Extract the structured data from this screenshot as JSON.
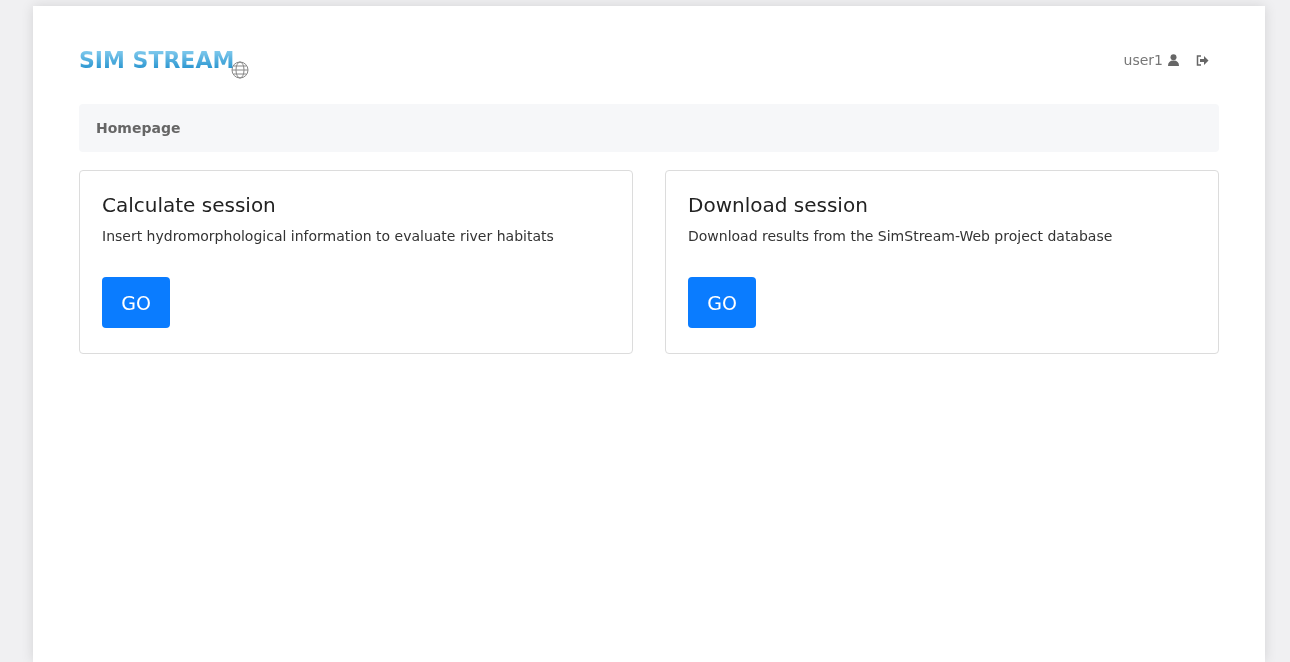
{
  "header": {
    "logo": "SIM STREAM",
    "user": "user1"
  },
  "breadcrumb": {
    "label": "Homepage"
  },
  "cards": [
    {
      "title": "Calculate session",
      "text": "Insert hydromorphological information to evaluate river habitats",
      "button": "GO"
    },
    {
      "title": "Download session",
      "text": "Download results from the SimStream-Web project database",
      "button": "GO"
    }
  ]
}
